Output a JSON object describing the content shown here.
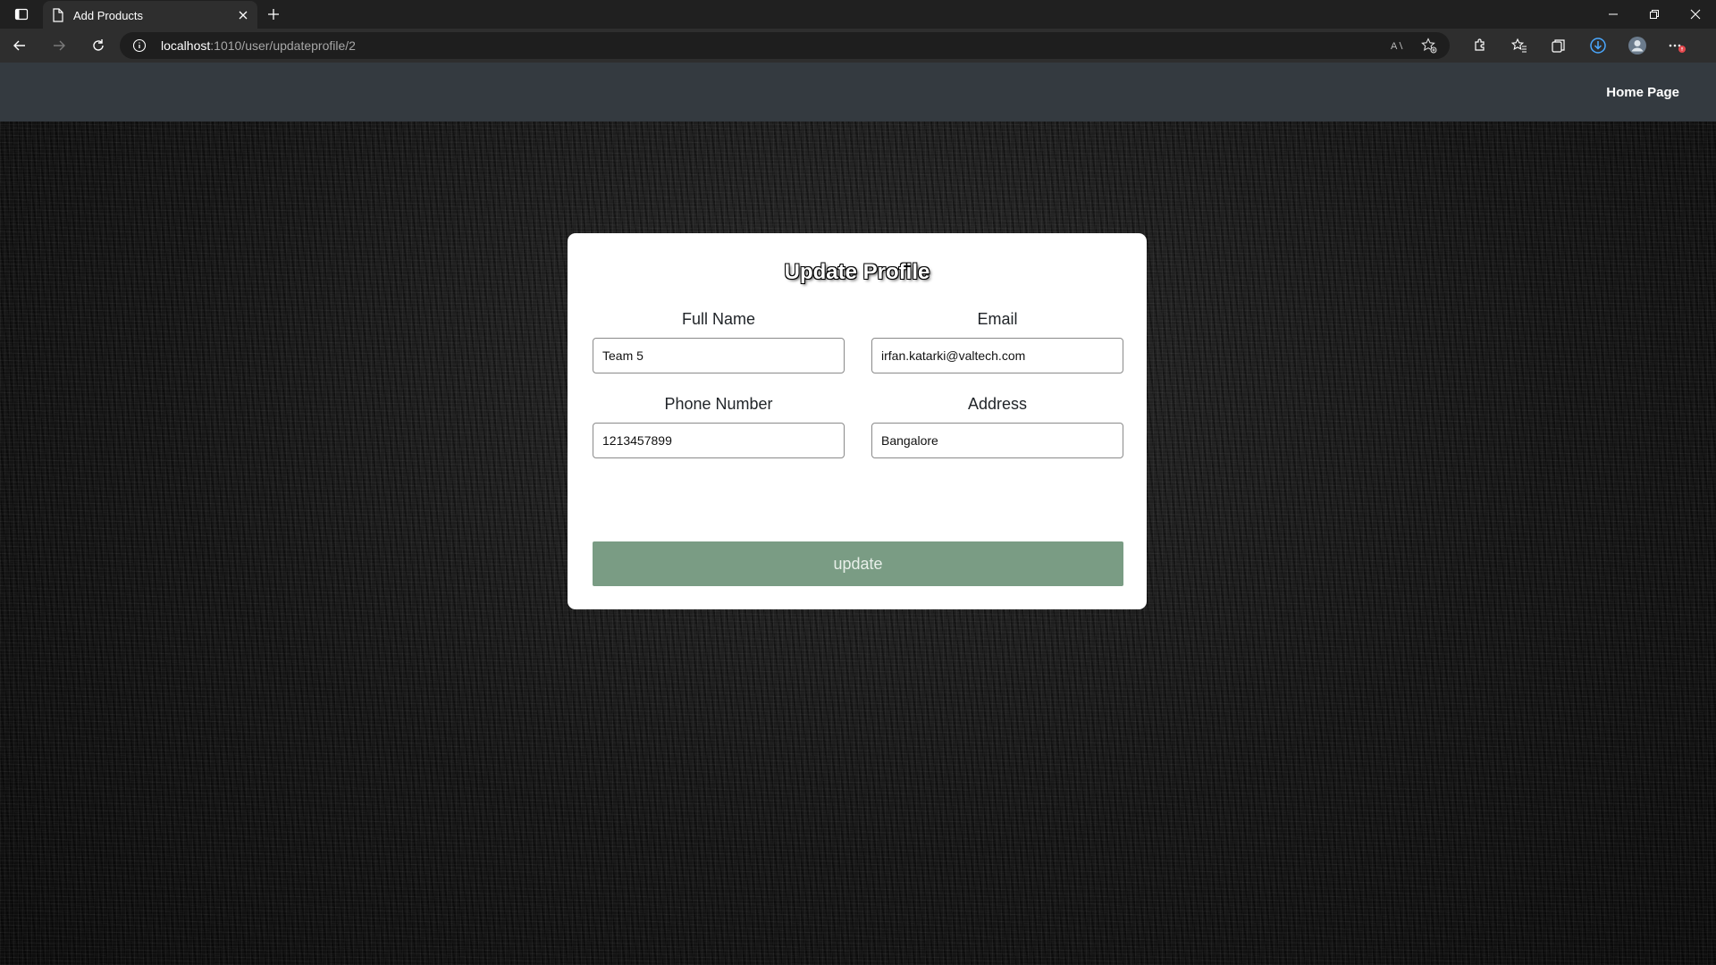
{
  "browser": {
    "tab_title": "Add Products",
    "url_host": "localhost",
    "url_path": ":1010/user/updateprofile/2"
  },
  "navbar": {
    "home_link": "Home Page"
  },
  "form": {
    "title": "Update Profile",
    "full_name_label": "Full Name",
    "full_name_value": "Team 5",
    "email_label": "Email",
    "email_value": "irfan.katarki@valtech.com",
    "phone_label": "Phone Number",
    "phone_value": "1213457899",
    "address_label": "Address",
    "address_value": "Bangalore",
    "submit_label": "update"
  },
  "colors": {
    "navbar_bg": "#343a40",
    "button_bg": "#7a9c84",
    "card_bg": "#ffffff"
  }
}
